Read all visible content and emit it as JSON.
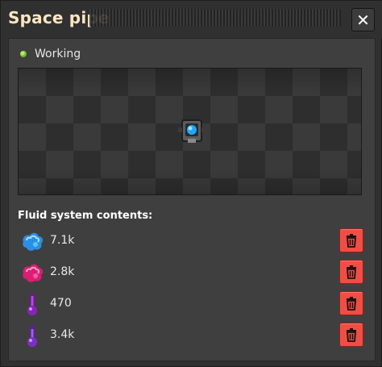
{
  "window": {
    "title": "Space pipe",
    "close_label": "✕"
  },
  "status": {
    "text": "Working",
    "color": "#7ad12a"
  },
  "fluids": {
    "section_title": "Fluid system contents:",
    "items": [
      {
        "icon": "fluoroketone-hot-icon",
        "amount": "7.1k",
        "color": "#3aa8ff"
      },
      {
        "icon": "fluoroketone-cold-icon",
        "amount": "2.8k",
        "color": "#e23b8c"
      },
      {
        "icon": "thruster-fuel-icon",
        "amount": "470",
        "color": "#8a22b8"
      },
      {
        "icon": "thruster-oxidizer-icon",
        "amount": "3.4k",
        "color": "#7b2fc8"
      }
    ]
  },
  "colors": {
    "delete_button": "#f14d44",
    "title_text": "#ffe6c0"
  }
}
